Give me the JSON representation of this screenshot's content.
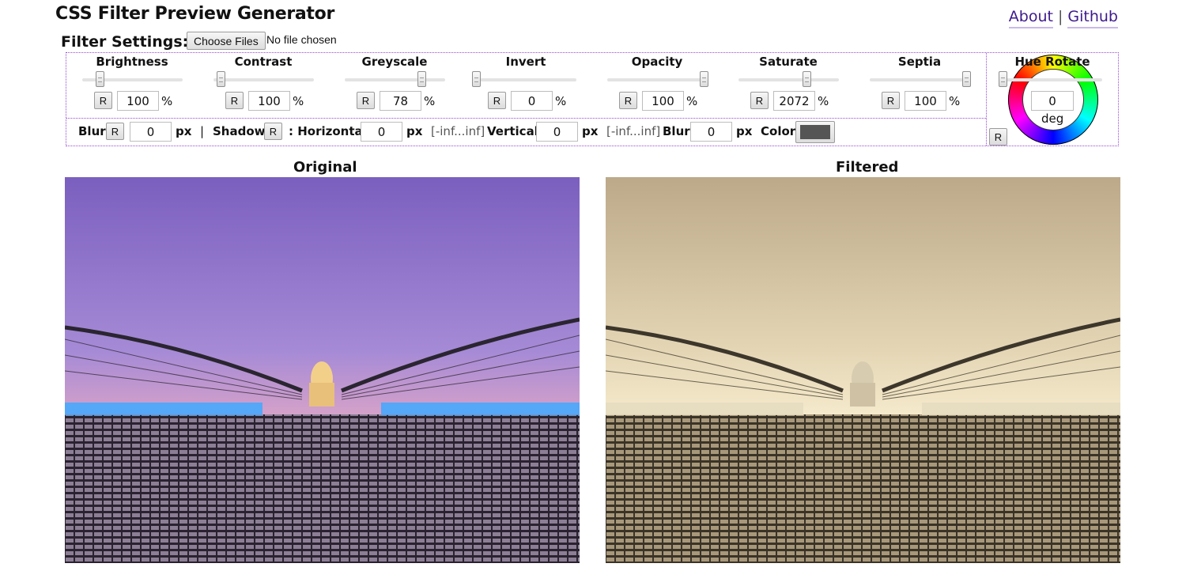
{
  "header": {
    "title": "CSS Filter Preview Generator",
    "about": "About",
    "separator": "|",
    "github": "Github"
  },
  "settings": {
    "label": "Filter Settings:",
    "file_button": "Choose Files",
    "file_status": "No file chosen"
  },
  "reset_label": "R",
  "sliders": [
    {
      "label": "Brightness",
      "value": "100",
      "unit": "%",
      "position": 0.17
    },
    {
      "label": "Contrast",
      "value": "100",
      "unit": "%",
      "position": 0.07
    },
    {
      "label": "Greyscale",
      "value": "78",
      "unit": "%",
      "position": 0.76
    },
    {
      "label": "Invert",
      "value": "0",
      "unit": "%",
      "position": 0.0
    },
    {
      "label": "Opacity",
      "value": "100",
      "unit": "%",
      "position": 0.96
    },
    {
      "label": "Saturate",
      "value": "2072",
      "unit": "%",
      "position": 0.68
    },
    {
      "label": "Septia",
      "value": "100",
      "unit": "%",
      "position": 0.96
    }
  ],
  "hue": {
    "label": "Hue Rotate",
    "value": "0",
    "unit": "deg",
    "position": 0.0
  },
  "row2": {
    "blur_label": "Blur",
    "blur_value": "0",
    "px": "px",
    "pipe": "|",
    "shadow_label": "Shadow",
    "horizontal_label": ": Horizontal",
    "horizontal_value": "0",
    "range_hint": "[-inf...inf]",
    "vertical_label": "Vertical",
    "vertical_value": "0",
    "shadow_blur_label": "Blur",
    "shadow_blur_value": "0",
    "color_label": "Color",
    "color_value": "#555555"
  },
  "previews": {
    "original": "Original",
    "filtered": "Filtered"
  }
}
